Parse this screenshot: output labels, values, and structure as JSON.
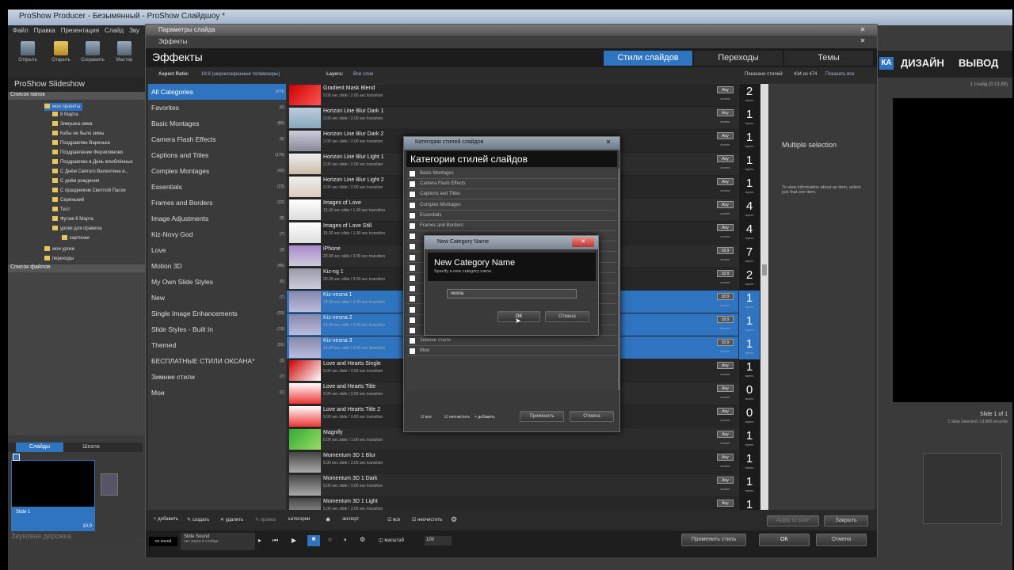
{
  "app": {
    "title": "ProShow Producer - Безымянный - ProShow Слайдшоу *",
    "menu": [
      "Файл",
      "Правка",
      "Презентация",
      "Слайд",
      "Зву"
    ],
    "toolbar": [
      "Открыть",
      "Открыть",
      "Сохранить",
      "Мастер"
    ],
    "show_title": "ProShow Slideshow",
    "folders_header": "Список папок",
    "files_header": "Список файлов",
    "folders": [
      "мои проекты",
      "8 Марта",
      "Зимушка-зима",
      "Кабы не было зимы",
      "Поздравляю Варенька",
      "Поздравление Ферзилиново",
      "Поздравляю в День влюблённых",
      "С Днём Святого Валентина и...",
      "С днём рождения",
      "С праздником Светлой Пасхи",
      "Серенький",
      "Тест",
      "Футаж 8 Марта",
      "уроки для правила",
      "картинки",
      "мои уроки",
      "переходы"
    ],
    "left_tabs": [
      "Слайды",
      "Шкала"
    ],
    "slide_label": "Slide 1",
    "slide_dur": "10.0",
    "sound_track": "Звуковая дорожка",
    "right_nav": [
      "КА",
      "ДИЗАЙН",
      "ВЫВОД"
    ],
    "right_info": "1 слайд (0:13.89)",
    "right_slide": "Slide 1 of 1",
    "right_selected": "1 Slide Selected | 13.889 seconds"
  },
  "fx": {
    "window_title": "Параметры слайда",
    "window_title2": "Эффекты",
    "heading": "Эффекты",
    "tabs": [
      "Стили слайдов",
      "Переходы",
      "Темы"
    ],
    "aspect_label": "Aspect Ratio:",
    "aspect_value": "16:9 (широкоэкранные телевизоры)",
    "layers_label": "Layers:",
    "layers_value": "Все слои",
    "shown_label": "Показано стилей:",
    "shown_value": "434 из 474",
    "show_all": "Показать все",
    "categories": [
      {
        "name": "All Categories",
        "count": "(474)"
      },
      {
        "name": "Favorites",
        "count": "(0)"
      },
      {
        "name": "Basic Montages",
        "count": "(86)"
      },
      {
        "name": "Camera Flash Effects",
        "count": "(9)"
      },
      {
        "name": "Captions and Titles",
        "count": "(175)"
      },
      {
        "name": "Complex Montages",
        "count": "(42)"
      },
      {
        "name": "Essentials",
        "count": "(23)"
      },
      {
        "name": "Frames and Borders",
        "count": "(22)"
      },
      {
        "name": "Image Adjustments",
        "count": "(8)"
      },
      {
        "name": "Kiz-Novy God",
        "count": "(7)"
      },
      {
        "name": "Love",
        "count": "(3)"
      },
      {
        "name": "Motion 3D",
        "count": "(46)"
      },
      {
        "name": "My Own Slide Styles",
        "count": "(0)"
      },
      {
        "name": "New",
        "count": "(7)"
      },
      {
        "name": "Single Image Enhancements",
        "count": "(33)"
      },
      {
        "name": "Slide Styles - Built In",
        "count": "(13)"
      },
      {
        "name": "Themed",
        "count": "(31)"
      },
      {
        "name": "БЕСПЛАТНЫЕ СТИЛИ ОКСАНА*",
        "count": "(3)"
      },
      {
        "name": "Зимние стили",
        "count": "(7)"
      },
      {
        "name": "Мои",
        "count": "(1)"
      }
    ],
    "styles": [
      {
        "name": "Gradient Mask Blend",
        "sub": "9.00 sec slide / 2.00 sec transition",
        "any": "Any",
        "anysub": "аспект",
        "num": "2",
        "unit": "layers"
      },
      {
        "name": "Horizon Line Blur Dark 1",
        "sub": "2.00 sec slide / 2.00 sec transition",
        "any": "Any",
        "anysub": "аспект",
        "num": "1",
        "unit": "layers"
      },
      {
        "name": "Horizon Line Blur Dark 2",
        "sub": "2.00 sec slide / 2.00 sec transition",
        "any": "Any",
        "anysub": "аспект",
        "num": "1",
        "unit": "layers"
      },
      {
        "name": "Horizon Line Blur Light 1",
        "sub": "2.00 sec slide / 2.00 sec transition",
        "any": "Any",
        "anysub": "аспект",
        "num": "1",
        "unit": "layers"
      },
      {
        "name": "Horizon Line Blur Light 2",
        "sub": "2.00 sec slide / 2.00 sec transition",
        "any": "Any",
        "anysub": "аспект",
        "num": "1",
        "unit": "layers"
      },
      {
        "name": "Images of Love",
        "sub": "15.00 sec slide / 1.00 sec transition",
        "any": "Any",
        "anysub": "аспект",
        "num": "4",
        "unit": "layers"
      },
      {
        "name": "Images of Love Still",
        "sub": "15.00 sec slide / 1.00 sec transition",
        "any": "Any",
        "anysub": "аспект",
        "num": "4",
        "unit": "layers"
      },
      {
        "name": "iPhone",
        "sub": "20.00 sec slide / 3.00 sec transition",
        "any": "16:9",
        "anysub": "аспект",
        "num": "7",
        "unit": "layers"
      },
      {
        "name": "Kiz-ng 1",
        "sub": "20.00 sec slide / 3.00 sec transition",
        "any": "16:9",
        "anysub": "аспект",
        "num": "2",
        "unit": "layers"
      },
      {
        "name": "Kiz-vesna 1",
        "sub": "10.00 sec slide / 3.00 sec transition",
        "any": "16:9",
        "anysub": "аспект",
        "num": "1",
        "unit": "layers"
      },
      {
        "name": "Kiz-vesna 2",
        "sub": "10.00 sec slide / 3.00 sec transition",
        "any": "16:9",
        "anysub": "аспект",
        "num": "1",
        "unit": "layers"
      },
      {
        "name": "Kiz-vesna 3",
        "sub": "10.00 sec slide / 3.00 sec transition",
        "any": "16:9",
        "anysub": "аспект",
        "num": "1",
        "unit": "layers"
      },
      {
        "name": "Love and Hearts Single",
        "sub": "9.00 sec slide / 3.00 sec transition",
        "any": "Any",
        "anysub": "аспект",
        "num": "1",
        "unit": "layers"
      },
      {
        "name": "Love and Hearts Title",
        "sub": "9.00 sec slide / 3.00 sec transition",
        "any": "Any",
        "anysub": "аспект",
        "num": "0",
        "unit": "layers"
      },
      {
        "name": "Love and Hearts Title 2",
        "sub": "9.00 sec slide / 3.00 sec transition",
        "any": "Any",
        "anysub": "аспект",
        "num": "0",
        "unit": "layers"
      },
      {
        "name": "Magnify",
        "sub": "5.00 sec slide / 1.00 sec transition",
        "any": "Any",
        "anysub": "аспект",
        "num": "1",
        "unit": "layers"
      },
      {
        "name": "Momentum 3D 1 Blur",
        "sub": "5.00 sec slide / 3.00 sec transition",
        "any": "Any",
        "anysub": "аспект",
        "num": "1",
        "unit": "layers"
      },
      {
        "name": "Momentum 3D 1 Dark",
        "sub": "5.00 sec slide / 3.00 sec transition",
        "any": "Any",
        "anysub": "аспект",
        "num": "1",
        "unit": "layers"
      },
      {
        "name": "Momentum 3D 1 Light",
        "sub": "5.00 sec slide / 3.00 sec transition",
        "any": "Any",
        "anysub": "аспект",
        "num": "1",
        "unit": "layers"
      }
    ],
    "detail_title": "Multiple selection",
    "detail_text": "To view information about an item, select just that one item.",
    "bottom_actions": [
      "добавить",
      "создать",
      "удалить",
      "правка",
      "категории",
      "экспорт",
      "все",
      "неочистить"
    ],
    "btn_apply_disabled": "Apply to slide",
    "btn_close": "Закрыть",
    "footer_sound": "no sound",
    "footer_slide": "Slide Sound",
    "footer_slide_sub": "нет звука в слайде",
    "footer_zoom": "100",
    "btn_apply_theme": "Применить стиль",
    "btn_ok": "OK",
    "btn_cancel": "Отмена"
  },
  "cat_dialog": {
    "title": "Категории стилей слайдов",
    "heading": "Категории стилей слайдов",
    "items": [
      "Basic Montages",
      "Camera Flash Effects",
      "Captions and Titles",
      "Complex Montages",
      "Essentials",
      "Frames and Borders",
      "",
      "",
      "",
      "",
      "",
      "",
      "",
      "",
      "",
      "",
      "Зимние стили",
      "Мои"
    ],
    "check_all": "все",
    "check_none": "неочистить",
    "add": "добавить",
    "apply": "Применить",
    "cancel": "Отмена"
  },
  "new_cat": {
    "title": "New Category Name",
    "heading": "New Category Name",
    "hint": "Specify a new category name.",
    "value": "vesna",
    "ok": "OK",
    "cancel": "Отмена"
  }
}
